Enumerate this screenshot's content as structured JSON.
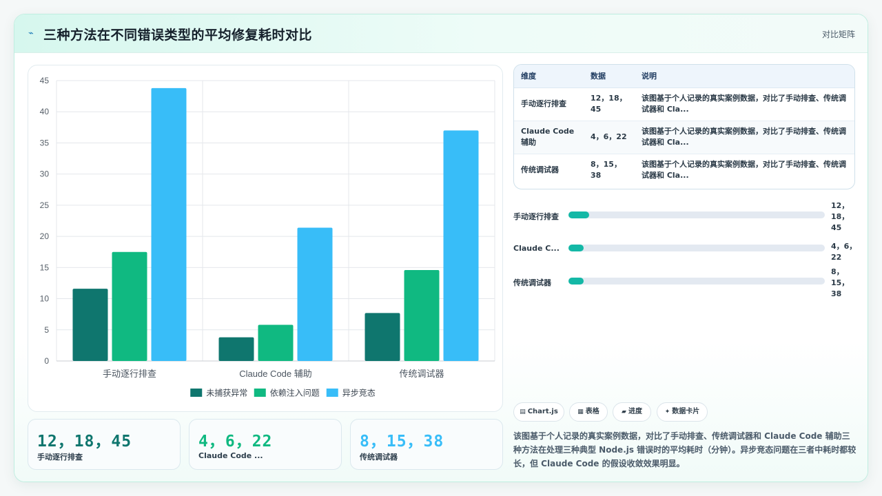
{
  "header": {
    "title": "三种方法在不同错误类型的平均修复耗时对比",
    "bolt_icon": "⌁",
    "right_label": "对比矩阵"
  },
  "chart_data": {
    "type": "bar",
    "categories": [
      "手动逐行排查",
      "Claude Code 辅助",
      "传统调试器"
    ],
    "series": [
      {
        "name": "未捕获异常",
        "color": "#0f766e",
        "values": [
          11.6,
          3.8,
          7.7
        ]
      },
      {
        "name": "依赖注入问题",
        "color": "#10b981",
        "values": [
          17.5,
          5.8,
          14.6
        ]
      },
      {
        "name": "异步竞态",
        "color": "#38bdf8",
        "values": [
          43.8,
          21.4,
          37.0
        ]
      }
    ],
    "yticks": [
      "0",
      "5",
      "10",
      "15",
      "20",
      "25",
      "30",
      "35",
      "40",
      "45"
    ],
    "ylim": [
      0,
      45
    ],
    "legend_position": "bottom",
    "grid": true
  },
  "stats": [
    {
      "value": "12，18，45",
      "label": "手动逐行排查",
      "color": "#0f766e"
    },
    {
      "value": "4，6，22",
      "label": "Claude Code ...",
      "color": "#10b981"
    },
    {
      "value": "8，15，38",
      "label": "传统调试器",
      "color": "#38bdf8"
    }
  ],
  "table": {
    "headers": [
      "维度",
      "数据",
      "说明"
    ],
    "rows": [
      {
        "dim": "手动逐行排查",
        "data": "12，18，45",
        "note": "该图基于个人记录的真实案例数据，对比了手动排查、传统调试器和 Cla..."
      },
      {
        "dim": "Claude Code 辅助",
        "data": "4，6，22",
        "note": "该图基于个人记录的真实案例数据，对比了手动排查、传统调试器和 Cla..."
      },
      {
        "dim": "传统调试器",
        "data": "8，15，38",
        "note": "该图基于个人记录的真实案例数据，对比了手动排查、传统调试器和 Cla..."
      }
    ]
  },
  "progress": [
    {
      "label": "手动逐行排查",
      "value": "12，18，45",
      "fraction": 0.08
    },
    {
      "label": "Claude C...",
      "value": "4，6，22",
      "fraction": 0.06
    },
    {
      "label": "传统调试器",
      "value": "8，15，38",
      "fraction": 0.06
    }
  ],
  "chips": [
    {
      "icon": "▤",
      "label": "Chart.js"
    },
    {
      "icon": "▦",
      "label": "表格"
    },
    {
      "icon": "▰",
      "label": "进度"
    },
    {
      "icon": "✦",
      "label": "数据卡片"
    }
  ],
  "description": "该图基于个人记录的真实案例数据，对比了手动排查、传统调试器和 Claude Code 辅助三种方法在处理三种典型 Node.js 错误时的平均耗时（分钟）。异步竞态问题在三者中耗时都较长，但 Claude Code 的假设收敛效果明显。"
}
